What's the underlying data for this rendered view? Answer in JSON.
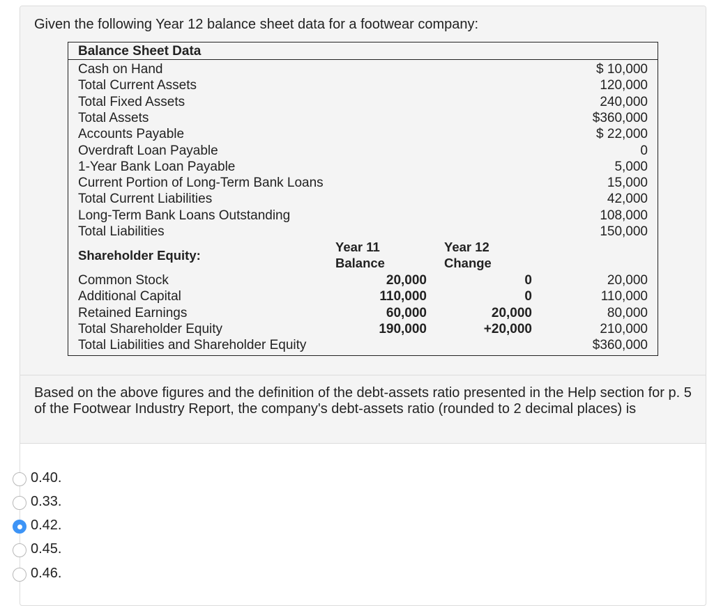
{
  "intro": "Given the following Year 12 balance sheet data for a footwear company:",
  "balance_sheet": {
    "title": "Balance Sheet Data",
    "rows": [
      {
        "label": "Cash on Hand",
        "value": "$ 10,000"
      },
      {
        "label": "Total Current Assets",
        "value": "120,000"
      },
      {
        "label": "Total Fixed Assets",
        "value": "240,000"
      },
      {
        "label": "Total Assets",
        "value": "$360,000"
      },
      {
        "label": "Accounts Payable",
        "value": "$ 22,000"
      },
      {
        "label": "Overdraft Loan Payable",
        "value": "0"
      },
      {
        "label": "1-Year Bank Loan Payable",
        "value": "5,000"
      },
      {
        "label": "Current Portion of Long-Term Bank Loans",
        "value": "15,000"
      },
      {
        "label": "Total Current Liabilities",
        "value": "42,000"
      },
      {
        "label": "Long-Term Bank Loans Outstanding",
        "value": "108,000"
      },
      {
        "label": "Total Liabilities",
        "value": "150,000"
      }
    ],
    "equity": {
      "heading": "Shareholder Equity:",
      "col_year11_line1": "Year 11",
      "col_year11_line2": "Balance",
      "col_year12_line1": "Year 12",
      "col_year12_line2": "Change",
      "rows": [
        {
          "label": "Common Stock",
          "year11": "20,000",
          "change": "0",
          "value": "20,000"
        },
        {
          "label": "Additional Capital",
          "year11": "110,000",
          "change": "0",
          "value": "110,000"
        },
        {
          "label": "Retained Earnings",
          "year11": "60,000",
          "change": "20,000",
          "value": "80,000"
        },
        {
          "label": "Total Shareholder Equity",
          "year11": "190,000",
          "change": "+20,000",
          "value": "210,000"
        }
      ],
      "total": {
        "label": "Total Liabilities and Shareholder Equity",
        "value": "$360,000"
      }
    }
  },
  "question": "Based on the above figures and the definition of the debt-assets ratio presented in the Help section for p. 5 of the Footwear Industry Report, the company's debt-assets ratio (rounded to 2 decimal places) is",
  "answers": [
    {
      "label": "0.40.",
      "selected": false
    },
    {
      "label": "0.33.",
      "selected": false
    },
    {
      "label": "0.42.",
      "selected": true
    },
    {
      "label": "0.45.",
      "selected": false
    },
    {
      "label": "0.46.",
      "selected": false
    }
  ],
  "colors": {
    "selected_radio": "#3d94f6",
    "panel_bg": "#f4f4f4"
  }
}
